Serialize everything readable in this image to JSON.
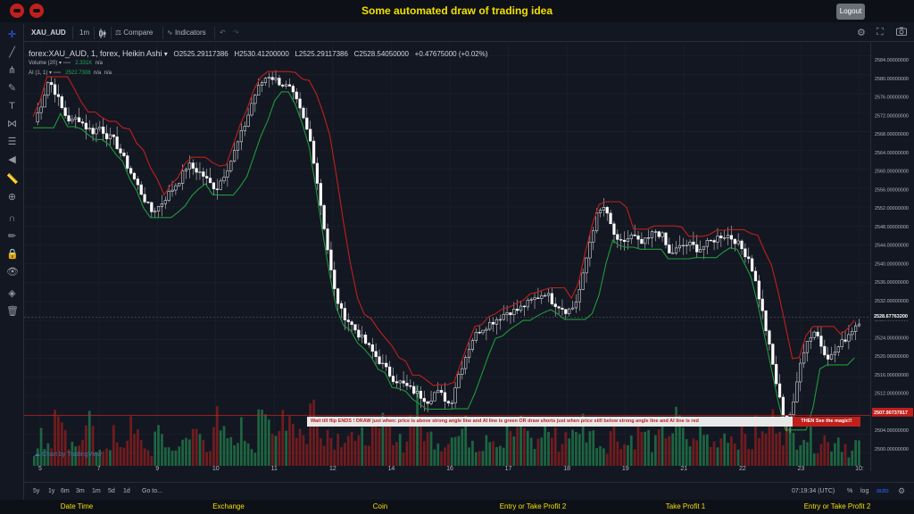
{
  "app": {
    "title": "Some automated draw of trading idea",
    "logout_label": "Logout"
  },
  "toolbar": {
    "symbol": "XAU_AUD",
    "interval": "1m",
    "compare_label": "Compare",
    "indicators_label": "Indicators"
  },
  "legend": {
    "symbol_line": "forex:XAU_AUD, 1, forex, Heikin Ashi",
    "open": "O2525.29117386",
    "high": "H2530.41200000",
    "low": "L2525.29117386",
    "close": "C2528.54050000",
    "change": "+0.47675000 (+0.02%)",
    "volume_label": "Volume (20)",
    "volume_value": "2.331K",
    "volume_na": "n/a",
    "ai_label": "AI (1, 1)",
    "ai_value": "2522.7308",
    "ai_na1": "n/a",
    "ai_na2": "n/a"
  },
  "price_axis": {
    "ticks": [
      "2584.00000000",
      "2580.00000000",
      "2576.00000000",
      "2572.00000000",
      "2568.00000000",
      "2564.00000000",
      "2560.00000000",
      "2556.00000000",
      "2552.00000000",
      "2548.00000000",
      "2544.00000000",
      "2540.00000000",
      "2536.00000000",
      "2532.00000000",
      "2528.00000000",
      "2524.00000000",
      "2520.00000000",
      "2516.00000000",
      "2512.00000000",
      "2508.00000000",
      "2504.00000000",
      "2500.00000000"
    ],
    "current_price": "2528.67763200",
    "line_price": "2507.90737817",
    "current_color": "#ffffff",
    "line_color": "#c0201c"
  },
  "time_axis": {
    "labels": [
      "5",
      "7",
      "9",
      "10",
      "11",
      "12",
      "14",
      "16",
      "17",
      "18",
      "19",
      "21",
      "22",
      "23",
      "10:"
    ]
  },
  "bottom": {
    "ranges": [
      "5y",
      "1y",
      "6m",
      "3m",
      "1m",
      "5d",
      "1d"
    ],
    "goto": "Go to...",
    "clock": "07:19:34 (UTC)",
    "percent": "%",
    "log": "log",
    "auto": "auto"
  },
  "banner": {
    "text": "Wait till flip ENDS  !  DRAW just when:  price is above strong angle line and AI line is green          OR          draw shorts just when price still below strong angle line and AI line is red",
    "magic": "THEN See the magic!!"
  },
  "watermark": "Chart by TradingView",
  "footer": {
    "columns": [
      "Date Time",
      "Exchange",
      "Coin",
      "Entry or Take Profit 2",
      "Take Profit 1",
      "Entry or Take Profit 2"
    ]
  },
  "chart_data": {
    "type": "candlestick",
    "ylim": [
      2498,
      2586
    ],
    "bull_color": "#ffffff",
    "bear_color": "#ffffff",
    "red_line_color": "#c0201c",
    "green_line_color": "#1f9a3a",
    "volume_up_color": "#26a65b",
    "volume_down_color": "#c0201c",
    "close_series": [
      2570,
      2574,
      2579,
      2576,
      2572,
      2570,
      2571,
      2569,
      2568,
      2569,
      2567,
      2566,
      2563,
      2560,
      2557,
      2554,
      2551,
      2552,
      2554,
      2556,
      2558,
      2561,
      2560,
      2559,
      2557,
      2556,
      2559,
      2562,
      2566,
      2570,
      2575,
      2578,
      2580,
      2579,
      2578,
      2577,
      2574,
      2570,
      2565,
      2555,
      2545,
      2535,
      2530,
      2528,
      2526,
      2524,
      2522,
      2520,
      2518,
      2516,
      2515,
      2514,
      2513,
      2512,
      2511,
      2513,
      2512,
      2510,
      2516,
      2520,
      2524,
      2526,
      2527,
      2528,
      2529,
      2530,
      2530,
      2531,
      2532,
      2533,
      2534,
      2532,
      2531,
      2530,
      2531,
      2536,
      2544,
      2550,
      2552,
      2548,
      2544,
      2545,
      2546,
      2544,
      2545,
      2547,
      2546,
      2542,
      2543,
      2544,
      2544,
      2543,
      2544,
      2545,
      2546,
      2546,
      2545,
      2543,
      2541,
      2535,
      2528,
      2520,
      2512,
      2506,
      2510,
      2520,
      2524,
      2526,
      2522,
      2520,
      2522,
      2524,
      2526,
      2528
    ],
    "volume_series": [
      2,
      4,
      3,
      9,
      5,
      3,
      2,
      4,
      6,
      3,
      2,
      4,
      3,
      5,
      4,
      3,
      2,
      4,
      3,
      2,
      4,
      3,
      5,
      4,
      3,
      6,
      4,
      3,
      5,
      4,
      3,
      9,
      5,
      4,
      8,
      7,
      5,
      4,
      8,
      6,
      5,
      4,
      4,
      5,
      3,
      4,
      5,
      4,
      6,
      5,
      4,
      3,
      8,
      5,
      4,
      4,
      3,
      5,
      4,
      5,
      4,
      3,
      5,
      4,
      3,
      5,
      4,
      6,
      4,
      3,
      5,
      4,
      3,
      5,
      4,
      6,
      5,
      4,
      3,
      5,
      4,
      3,
      4,
      5,
      4,
      3,
      4,
      5,
      6,
      4,
      3,
      5,
      4,
      3,
      4,
      5,
      4,
      4,
      3,
      5,
      4,
      6,
      7,
      5,
      4,
      5,
      4,
      3,
      4,
      3,
      4,
      3,
      2,
      3
    ]
  }
}
